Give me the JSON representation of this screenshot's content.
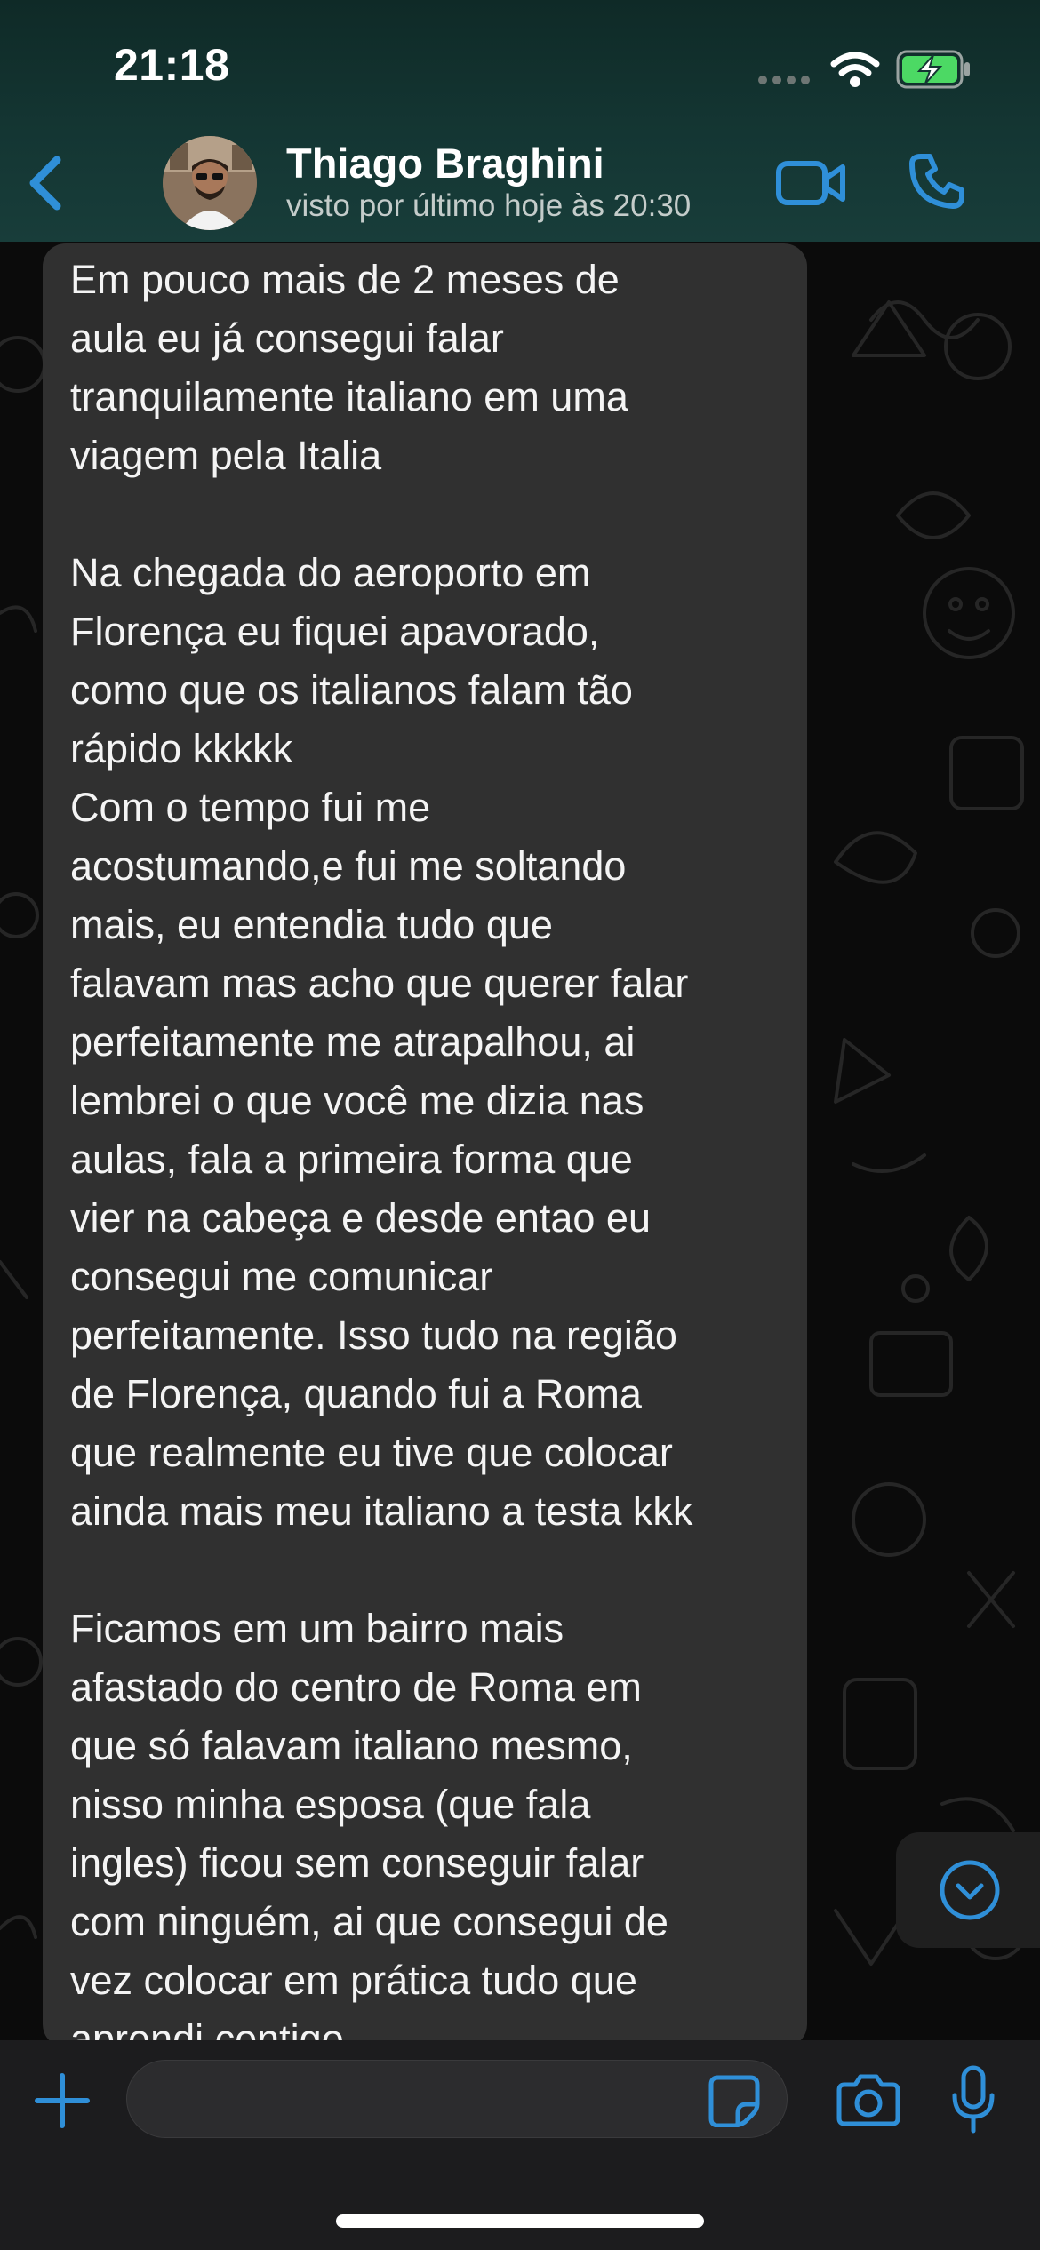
{
  "status_bar": {
    "time": "21:18"
  },
  "header": {
    "contact_name": "Thiago Braghini",
    "contact_status": "visto por último hoje às 20:30"
  },
  "message": {
    "text": "Em pouco mais de 2 meses de\naula eu já consegui falar\ntranquilamente italiano em uma\nviagem pela Italia\n\nNa chegada do aeroporto em\nFlorença eu fiquei apavorado,\ncomo que os italianos falam tão\nrápido kkkkk\nCom o tempo fui me\nacostumando,e fui me soltando\nmais, eu entendia tudo que\nfalavam mas acho que querer falar\nperfeitamente me atrapalhou, ai\nlembrei o que você me dizia nas\naulas, fala a primeira forma que\nvier na cabeça e desde entao eu\nconsegui me comunicar\nperfeitamente. Isso tudo na região\nde Florença, quando fui a Roma\nque realmente eu tive que colocar\nainda mais meu italiano a testa kkk\n\nFicamos em um bairro mais\nafastado do centro de Roma em\nque só falavam italiano mesmo,\nnisso minha esposa (que fala\ningles) ficou sem conseguir falar\ncom ninguém, ai que consegui de\nvez colocar em prática tudo que\naprendi contigo"
  },
  "composer": {
    "input_value": "",
    "input_placeholder": ""
  },
  "icons": {
    "back": "chevron-left-icon",
    "video": "video-camera-icon",
    "call": "phone-icon",
    "scroll_down": "chevron-down-circle-icon",
    "plus": "plus-icon",
    "sticker": "sticker-icon",
    "camera": "camera-icon",
    "mic": "microphone-icon"
  },
  "colors": {
    "accent": "#2f8fd8",
    "bubble": "#303030",
    "header": "#143633",
    "battery_fill": "#4cd964"
  }
}
